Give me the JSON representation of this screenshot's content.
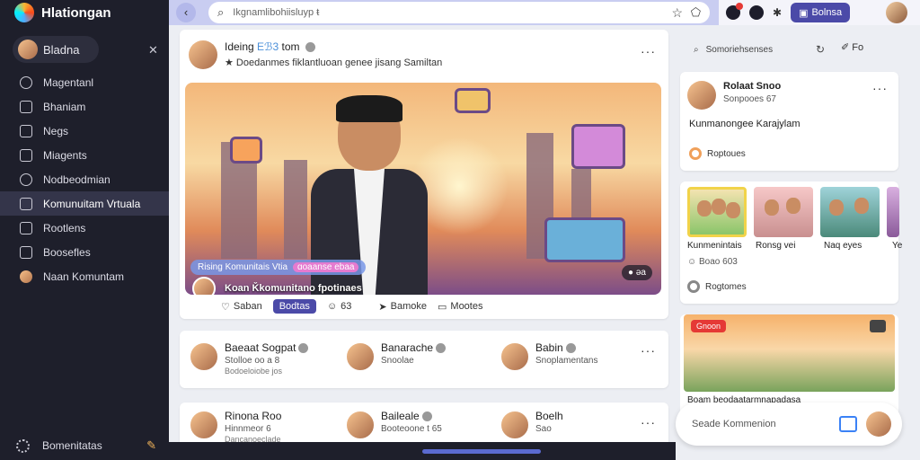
{
  "app": {
    "title": "Hlationgan"
  },
  "sidebar": {
    "profile_name": "Bladna",
    "items": [
      {
        "label": "Magentanl",
        "icon": "home-icon"
      },
      {
        "label": "Bhaniam",
        "icon": "bookmark-icon"
      },
      {
        "label": "Negs",
        "icon": "message-icon"
      },
      {
        "label": "Miagents",
        "icon": "box-icon"
      },
      {
        "label": "Nodbeodmian",
        "icon": "clock-icon"
      },
      {
        "label": "Komunuitam Vrtuala",
        "icon": "community-icon",
        "active": true
      },
      {
        "label": "Rootlens",
        "icon": "grid-icon"
      },
      {
        "label": "Boosefles",
        "icon": "layers-icon"
      },
      {
        "label": "Naan Komuntam",
        "icon": "avatar-icon"
      }
    ],
    "footer_label": "Bomenitatas"
  },
  "topbar": {
    "search_placeholder": "Ikgnamlibohiisluyp ᵵ",
    "button_label": "Bolnsa"
  },
  "post": {
    "author": "Ideing",
    "author_tag": "Eℬ3",
    "author_time": "tom",
    "caption": "Doedanmes fiklantluoan genee jisang Samiltan",
    "chip_text": "Rising Komunitais Vtia",
    "chip_pill": "ɑoaanse ebaa",
    "live_title": "Koan Ǩkomunitano fpotinaes",
    "live_count": "ǝa",
    "actions": {
      "like": "Saban",
      "button": "Bodtas",
      "count": "63",
      "share": "Bamoke",
      "comment": "Mootes"
    }
  },
  "row1": [
    {
      "name": "Baeaat Sogpat",
      "sub": "Stolloe oo a 8",
      "sub2": "Bodoeloiobe jos"
    },
    {
      "name": "Banarache",
      "sub": "Snoolae",
      "sub2": ""
    },
    {
      "name": "Babin",
      "sub": "Snoplamentans",
      "sub2": ""
    }
  ],
  "row2": [
    {
      "name": "Rinona Roo",
      "sub": "Hinnmeor 6",
      "sub2": "Dancanoeclade"
    },
    {
      "name": "Baileale",
      "sub": "Booteoone t 65",
      "sub2": ""
    },
    {
      "name": "Boelh",
      "sub": "Sao",
      "sub2": ""
    }
  ],
  "right": {
    "search_placeholder": "Somoriehsenses",
    "post_label": "Fo",
    "card1": {
      "name": "Rolaat Snoo",
      "sub": "Sonpooes 67",
      "text": "Kunmanongee Karajylam",
      "reaction": "Roptoues"
    },
    "card2": {
      "labels": [
        "Kunmenintais",
        "Ronsg vei",
        "Naq eyes",
        "Ye"
      ],
      "sub": "Boao 603",
      "footer": "Rogtomes"
    },
    "promo": {
      "badge": "Gnoon",
      "text": "Boam beodaatarmnapadasa"
    },
    "comment_placeholder": "Seade Kommenion"
  }
}
